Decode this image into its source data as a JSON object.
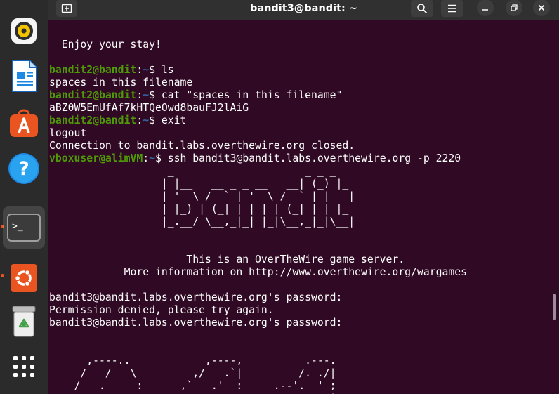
{
  "window": {
    "title": "bandit3@bandit: ~"
  },
  "dock": {
    "items": [
      {
        "name": "rhythmbox-icon"
      },
      {
        "name": "libreoffice-writer-icon"
      },
      {
        "name": "app-center-icon"
      },
      {
        "name": "help-icon",
        "glyph": "?"
      },
      {
        "name": "terminal-icon",
        "glyph": ">_"
      },
      {
        "name": "ubuntu-icon"
      },
      {
        "name": "trash-icon"
      },
      {
        "name": "show-apps-icon"
      }
    ]
  },
  "terminal": {
    "lines": [
      {
        "text": "  Enjoy your stay!"
      },
      {
        "text": ""
      },
      {
        "user": "bandit2@bandit",
        "path": "~",
        "cmd": " ls"
      },
      {
        "text": "spaces in this filename"
      },
      {
        "user": "bandit2@bandit",
        "path": "~",
        "cmd": " cat \"spaces in this filename\""
      },
      {
        "text": "aBZ0W5EmUfAf7kHTQeOwd8bauFJ2lAiG"
      },
      {
        "user": "bandit2@bandit",
        "path": "~",
        "cmd": " exit"
      },
      {
        "text": "logout"
      },
      {
        "text": "Connection to bandit.labs.overthewire.org closed."
      },
      {
        "user": "vboxuser@alimVM",
        "path": "~",
        "cmd": " ssh bandit3@bandit.labs.overthewire.org -p 2220"
      },
      {
        "text": "                   _                     _ _ _   "
      },
      {
        "text": "                  | |__   __ _ _ __   __| (_) |_ "
      },
      {
        "text": "                  | '_ \\ / _` | '_ \\ / _` | | __|"
      },
      {
        "text": "                  | |_) | (_| | | | | (_| | | |_ "
      },
      {
        "text": "                  |_.__/ \\__,_|_| |_|\\__,_|_|\\__|"
      },
      {
        "text": ""
      },
      {
        "text": ""
      },
      {
        "text": "                      This is an OverTheWire game server."
      },
      {
        "text": "            More information on http://www.overthewire.org/wargames"
      },
      {
        "text": ""
      },
      {
        "text": "bandit3@bandit.labs.overthewire.org's password:"
      },
      {
        "text": "Permission denied, please try again."
      },
      {
        "text": "bandit3@bandit.labs.overthewire.org's password:"
      },
      {
        "text": ""
      },
      {
        "text": ""
      },
      {
        "text": "      ,----..            ,----,          .---."
      },
      {
        "text": "     /   /   \\         ,/   .`|         /. ./|"
      },
      {
        "text": "    /   .     :      ,`   .'  :     .--'.  ' ;"
      },
      {
        "text": "   .   /   ;.  \\   ;    ;     /    /__./ \\ : |"
      }
    ]
  },
  "colors": {
    "terminal_bg": "#300a24",
    "prompt_user": "#4e9a06",
    "prompt_path": "#3465a4",
    "titlebar": "#303030",
    "dock_bg": "#2b2b2b",
    "accent": "#e95420"
  }
}
